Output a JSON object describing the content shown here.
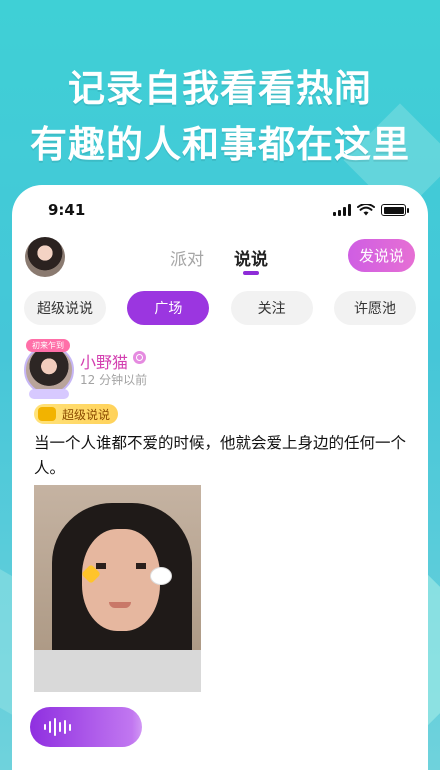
{
  "headline": {
    "line1": "记录自我看看热闹",
    "line2": "有趣的人和事都在这里"
  },
  "status_bar": {
    "time": "9:41"
  },
  "top_nav": {
    "tabs": [
      "派对",
      "说说"
    ],
    "active_tab": "说说",
    "post_button": "发说说"
  },
  "filter_chips": [
    {
      "label": "超级说说",
      "active": false
    },
    {
      "label": "广场",
      "active": true
    },
    {
      "label": "关注",
      "active": false
    },
    {
      "label": "许愿池",
      "active": false
    }
  ],
  "post": {
    "badge": "初来乍到",
    "username": "小野猫",
    "time_ago": "12 分钟以前",
    "tag": "超级说说",
    "text": "当一个人谁都不爱的时候，他就会爱上身边的任何一个人。"
  },
  "colors": {
    "accent": "#9b36e0",
    "username": "#d33fb0",
    "background_top": "#3fd0d6"
  },
  "icons": [
    "signal-icon",
    "wifi-icon",
    "battery-icon",
    "verified-icon",
    "super-tag-icon",
    "voice-wave-icon"
  ]
}
